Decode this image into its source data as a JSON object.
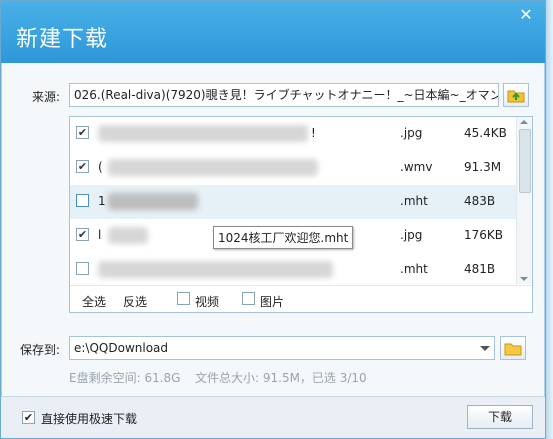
{
  "dialog": {
    "title": "新建下载",
    "close_glyph": "✕"
  },
  "source": {
    "label": "来源:",
    "value": "026.(Real-diva)(7920)覗き見！ライブチャットオナニー！_~日本編~_オマン",
    "icon": "upload-folder-icon"
  },
  "files": {
    "rows": [
      {
        "checked": true,
        "name_fragment": "!",
        "ext": ".jpg",
        "size": "45.4KB"
      },
      {
        "checked": true,
        "name_fragment": "(",
        "ext": ".wmv",
        "size": "91.3M"
      },
      {
        "checked": false,
        "name_fragment": "1",
        "ext": ".mht",
        "size": "483B"
      },
      {
        "checked": true,
        "name_fragment": "l",
        "ext": ".jpg",
        "size": "176KB"
      },
      {
        "checked": false,
        "name_fragment": "",
        "ext": ".mht",
        "size": "481B"
      }
    ],
    "tooltip": "1024核工厂欢迎您.mht",
    "filter": {
      "select_all": "全选",
      "invert": "反选",
      "video": "视频",
      "image": "图片"
    }
  },
  "save": {
    "label": "保存到:",
    "path": "e:\\QQDownload",
    "icon": "folder-icon"
  },
  "info": {
    "disk_space": "E盘剩余空间: 61.8G",
    "total": "文件总大小: 91.5M，已选 3/10"
  },
  "footer": {
    "fast_download_label": "直接使用极速下载",
    "fast_download_checked": true,
    "download_button": "下载"
  }
}
